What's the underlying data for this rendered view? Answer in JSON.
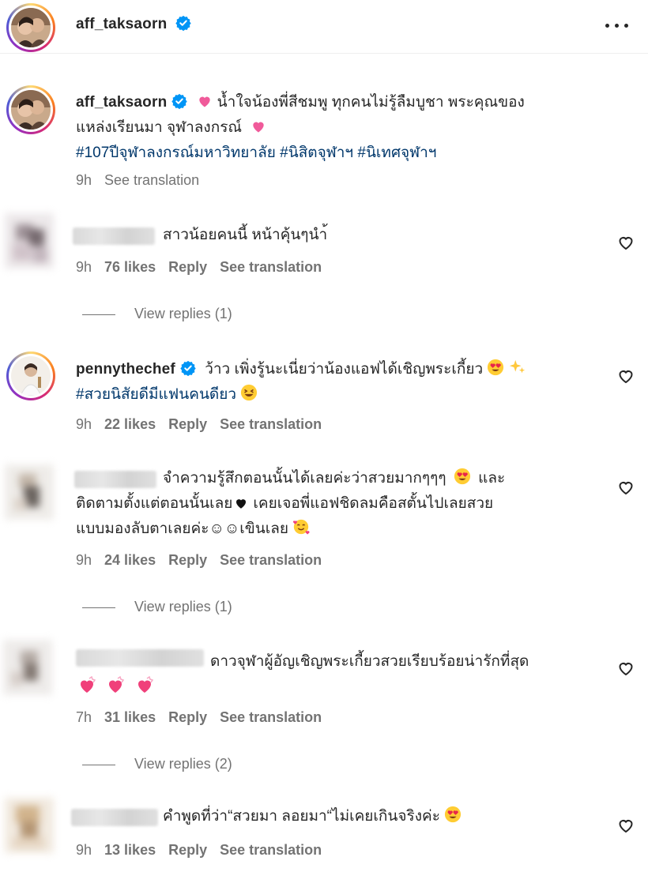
{
  "post_header": {
    "username": "aff_taksaorn",
    "more_icon": "more-horizontal-icon"
  },
  "caption": {
    "username": "aff_taksaorn",
    "text_1": "น้ำใจน้องพี่สีชมพู ทุกคนไม่รู้ลืมบูชา พระคุณของ",
    "text_2": "แหล่งเรียนมา จุฬาลงกรณ์",
    "hashtags": "#107ปีจุฬาลงกรณ์มหาวิทยาลัย #นิสิตจุฬาฯ #นิเทศจุฬาฯ",
    "time": "9h",
    "see_translation": "See translation"
  },
  "comments": [
    {
      "text": "สาวน้อยคนนี้ หน้าคุ้นๆนำ้",
      "time": "9h",
      "likes": "76 likes",
      "reply": "Reply",
      "see_translation": "See translation",
      "view_replies": "View replies (1)"
    },
    {
      "username": "pennythechef",
      "text_1": "ว้าว เพิ่งรู้นะเนี่ยว่าน้องแอฟได้เชิญพระเกี้ยว",
      "text_2": "#สวยนิสัยดีมีแฟนคนดียว",
      "time": "9h",
      "likes": "22 likes",
      "reply": "Reply",
      "see_translation": "See translation"
    },
    {
      "text_1": "จำความรู้สึกตอนนั้นได้เลยค่ะว่าสวยมากๆๆๆ",
      "text_1b": "และ",
      "text_2": "ติดตามตั้งแต่ตอนนั้นเลย",
      "text_2b": "เคยเจอพี่แอฟชิดลมคือสตั้นไปเลยสวย",
      "text_3": "แบบมองลับตาเลยค่ะ☺☺เขินเลย",
      "time": "9h",
      "likes": "24 likes",
      "reply": "Reply",
      "see_translation": "See translation",
      "view_replies": "View replies (1)"
    },
    {
      "text": "ดาวจุฬาผู้อัญเชิญพระเกี้ยวสวยเรียบร้อยน่ารักที่สุด",
      "time": "7h",
      "likes": "31 likes",
      "reply": "Reply",
      "see_translation": "See translation",
      "view_replies": "View replies (2)"
    },
    {
      "text": "คำพูดที่ว่า“สวยมา ลอยมา“ไม่เคยเกินจริงค่ะ",
      "time": "9h",
      "likes": "13 likes",
      "reply": "Reply",
      "see_translation": "See translation"
    }
  ],
  "colors": {
    "text": "#262626",
    "secondary": "#737373",
    "hashtag": "#00376b",
    "verified": "#0095f6"
  }
}
